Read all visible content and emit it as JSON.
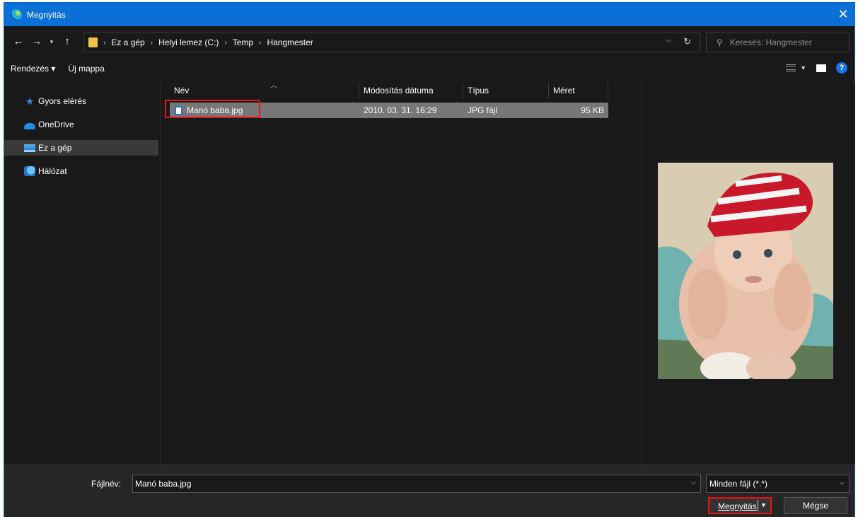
{
  "window": {
    "title": "Megnyitás",
    "close_icon": "✕"
  },
  "address": {
    "crumbs": [
      "Ez a gép",
      "Helyi lemez (C:)",
      "Temp",
      "Hangmester"
    ],
    "search_placeholder": "Keresés: Hangmester"
  },
  "toolbar": {
    "organize": "Rendezés ▾",
    "new_folder": "Új mappa"
  },
  "nav": {
    "items": [
      {
        "label": "Gyors elérés",
        "icon": "star-icon"
      },
      {
        "label": "OneDrive",
        "icon": "cloud-icon"
      },
      {
        "label": "Ez a gép",
        "icon": "pc-icon"
      },
      {
        "label": "Hálózat",
        "icon": "network-icon"
      }
    ]
  },
  "files": {
    "columns": [
      "Név",
      "Módosítás dátuma",
      "Típus",
      "Méret"
    ],
    "rows": [
      {
        "name": "Manó baba.jpg",
        "modified": "2010. 03. 31. 16:29",
        "type": "JPG fájl",
        "size": "95 KB"
      }
    ]
  },
  "bottom": {
    "filename_label": "Fájlnév:",
    "filename_value": "Manó baba.jpg",
    "filter_value": "Minden fájl (*.*)",
    "open_label": "Megnyitás",
    "cancel_label": "Mégse"
  },
  "colors": {
    "accent": "#0a6fd6",
    "highlight": "#e11111",
    "selected_row": "#777777"
  }
}
